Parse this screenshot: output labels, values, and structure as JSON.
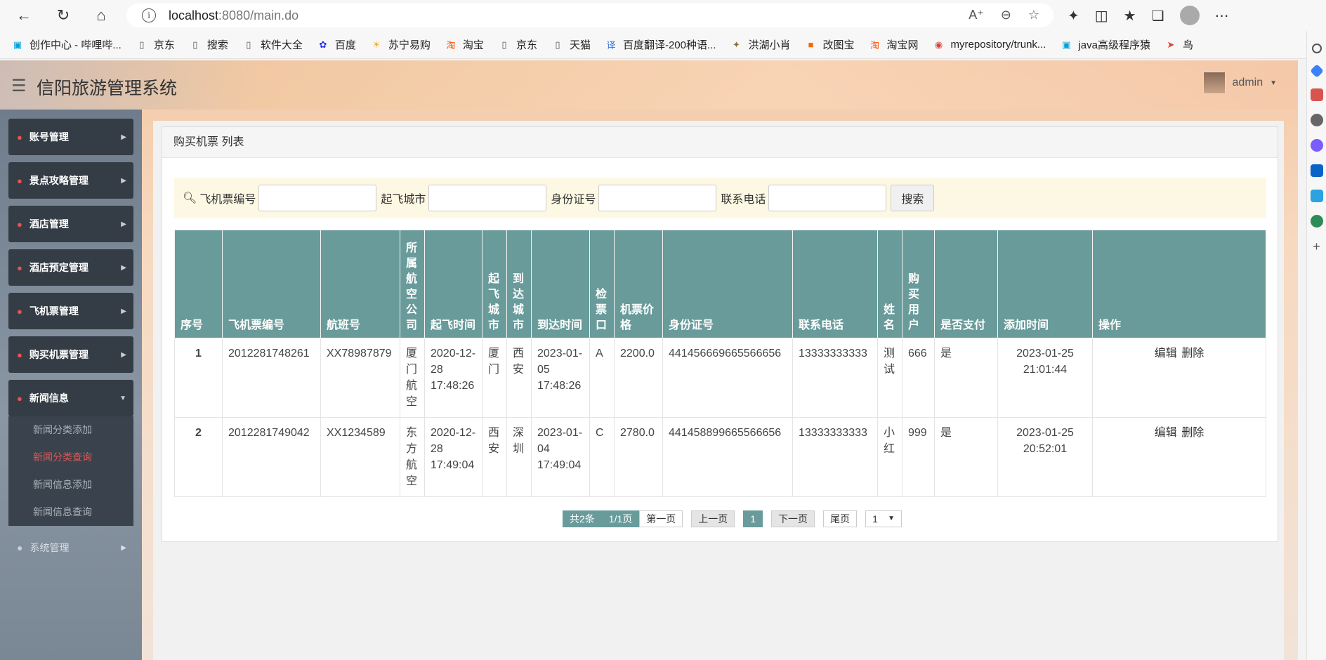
{
  "browser": {
    "url_host": "localhost",
    "url_rest": ":8080/main.do",
    "bookmarks": [
      {
        "label": "创作中心 - 哔哩哔...",
        "icon": "tv-icon",
        "color": "#00a1d6"
      },
      {
        "label": "京东",
        "icon": "page-icon",
        "color": "#555555"
      },
      {
        "label": "搜索",
        "icon": "page-icon",
        "color": "#555555"
      },
      {
        "label": "软件大全",
        "icon": "page-icon",
        "color": "#555555"
      },
      {
        "label": "百度",
        "icon": "paw-icon",
        "color": "#2932e1"
      },
      {
        "label": "苏宁易购",
        "icon": "lion-icon",
        "color": "#f5a623"
      },
      {
        "label": "淘宝",
        "icon": "tao-icon",
        "color": "#ff5000"
      },
      {
        "label": "京东",
        "icon": "page-icon",
        "color": "#555555"
      },
      {
        "label": "天猫",
        "icon": "page-icon",
        "color": "#555555"
      },
      {
        "label": "百度翻译-200种语...",
        "icon": "translate-icon",
        "color": "#2f6de1"
      },
      {
        "label": "洪湖小肖",
        "icon": "bird-icon",
        "color": "#8a6d3b"
      },
      {
        "label": "改图宝",
        "icon": "image-icon",
        "color": "#f56a00"
      },
      {
        "label": "淘宝网",
        "icon": "tao-icon",
        "color": "#ff5000"
      },
      {
        "label": "myrepository/trunk...",
        "icon": "chrome-icon",
        "color": "#db4437"
      },
      {
        "label": "java高级程序猿",
        "icon": "tv-icon",
        "color": "#00a1d6"
      },
      {
        "label": "鸟",
        "icon": "plane-icon",
        "color": "#e03c31"
      }
    ]
  },
  "app": {
    "title": "信阳旅游管理系统",
    "user": "admin"
  },
  "sidebar": {
    "items": [
      {
        "label": "账号管理"
      },
      {
        "label": "景点攻略管理"
      },
      {
        "label": "酒店管理"
      },
      {
        "label": "酒店预定管理"
      },
      {
        "label": "飞机票管理"
      },
      {
        "label": "购买机票管理"
      },
      {
        "label": "新闻信息"
      }
    ],
    "sub_items": [
      {
        "label": "新闻分类添加"
      },
      {
        "label": "新闻分类查询"
      },
      {
        "label": "新闻信息添加"
      },
      {
        "label": "新闻信息查询"
      }
    ],
    "system": "系统管理"
  },
  "panel": {
    "title": "购买机票 列表"
  },
  "search": {
    "ticket_no_label": "飞机票编号",
    "from_city_label": "起飞城市",
    "id_no_label": "身份证号",
    "phone_label": "联系电话",
    "button": "搜索"
  },
  "table": {
    "headers": {
      "seq": "序号",
      "ticket_no": "飞机票编号",
      "flight_no": "航班号",
      "airline": "所属航空公司",
      "depart_time": "起飞时间",
      "from_city": "起飞城市",
      "to_city": "到达城市",
      "arrive_time": "到达时间",
      "gate": "检票口",
      "price": "机票价格",
      "id_no": "身份证号",
      "phone": "联系电话",
      "name": "姓名",
      "buyer": "购买用户",
      "paid": "是否支付",
      "added": "添加时间",
      "ops": "操作"
    },
    "rows": [
      {
        "seq": "1",
        "ticket_no": "2012281748261",
        "flight_no": "XX78987879",
        "airline": "厦门航空",
        "depart_time": "2020-12-28 17:48:26",
        "from_city": "厦门",
        "to_city": "西安",
        "arrive_time": "2023-01-05 17:48:26",
        "gate": "A",
        "price": "2200.0",
        "id_no": "441456669665566656",
        "phone": "13333333333",
        "name": "测试",
        "buyer": "666",
        "paid": "是",
        "added": "2023-01-25 21:01:44",
        "edit": "编辑",
        "delete": "删除"
      },
      {
        "seq": "2",
        "ticket_no": "2012281749042",
        "flight_no": "XX1234589",
        "airline": "东方航空",
        "depart_time": "2020-12-28 17:49:04",
        "from_city": "西安",
        "to_city": "深圳",
        "arrive_time": "2023-01-04 17:49:04",
        "gate": "C",
        "price": "2780.0",
        "id_no": "441458899665566656",
        "phone": "13333333333",
        "name": "小红",
        "buyer": "999",
        "paid": "是",
        "added": "2023-01-25 20:52:01",
        "edit": "编辑",
        "delete": "删除"
      }
    ]
  },
  "pager": {
    "total": "共2条",
    "pages": "1/1页",
    "first": "第一页",
    "prev": "上一页",
    "current": "1",
    "next": "下一页",
    "last": "尾页",
    "select_value": "1"
  },
  "colors": {
    "accent": "#699b9b",
    "menu_bg": "#343c45",
    "menu_icon": "#e25555",
    "search_bg": "#fcf8e3"
  }
}
